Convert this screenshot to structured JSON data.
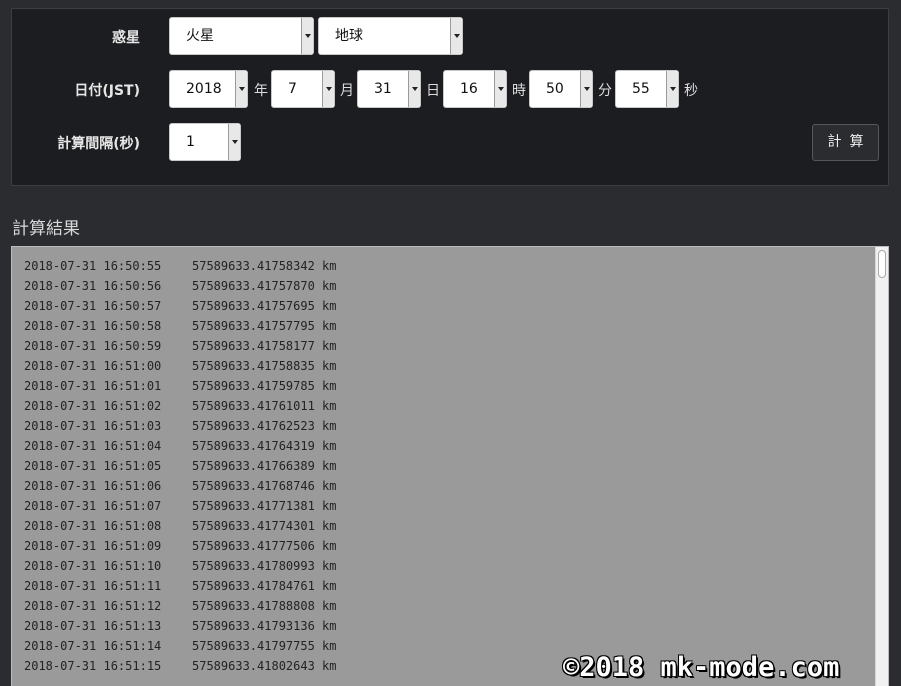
{
  "form": {
    "planet_label": "惑星",
    "planet_from": "火星",
    "planet_to": "地球",
    "date_label": "日付(JST)",
    "year": "2018",
    "year_unit": "年",
    "month": "7",
    "month_unit": "月",
    "day": "31",
    "day_unit": "日",
    "hour": "16",
    "hour_unit": "時",
    "minute": "50",
    "minute_unit": "分",
    "second": "55",
    "second_unit": "秒",
    "interval_label": "計算間隔(秒)",
    "interval": "1",
    "calc_button": "計算"
  },
  "results": {
    "title": "計算結果",
    "rows": [
      {
        "ts": "2018-07-31 16:50:55",
        "dist": "57589633.41758342 km"
      },
      {
        "ts": "2018-07-31 16:50:56",
        "dist": "57589633.41757870 km"
      },
      {
        "ts": "2018-07-31 16:50:57",
        "dist": "57589633.41757695 km"
      },
      {
        "ts": "2018-07-31 16:50:58",
        "dist": "57589633.41757795 km"
      },
      {
        "ts": "2018-07-31 16:50:59",
        "dist": "57589633.41758177 km"
      },
      {
        "ts": "2018-07-31 16:51:00",
        "dist": "57589633.41758835 km"
      },
      {
        "ts": "2018-07-31 16:51:01",
        "dist": "57589633.41759785 km"
      },
      {
        "ts": "2018-07-31 16:51:02",
        "dist": "57589633.41761011 km"
      },
      {
        "ts": "2018-07-31 16:51:03",
        "dist": "57589633.41762523 km"
      },
      {
        "ts": "2018-07-31 16:51:04",
        "dist": "57589633.41764319 km"
      },
      {
        "ts": "2018-07-31 16:51:05",
        "dist": "57589633.41766389 km"
      },
      {
        "ts": "2018-07-31 16:51:06",
        "dist": "57589633.41768746 km"
      },
      {
        "ts": "2018-07-31 16:51:07",
        "dist": "57589633.41771381 km"
      },
      {
        "ts": "2018-07-31 16:51:08",
        "dist": "57589633.41774301 km"
      },
      {
        "ts": "2018-07-31 16:51:09",
        "dist": "57589633.41777506 km"
      },
      {
        "ts": "2018-07-31 16:51:10",
        "dist": "57589633.41780993 km"
      },
      {
        "ts": "2018-07-31 16:51:11",
        "dist": "57589633.41784761 km"
      },
      {
        "ts": "2018-07-31 16:51:12",
        "dist": "57589633.41788808 km"
      },
      {
        "ts": "2018-07-31 16:51:13",
        "dist": "57589633.41793136 km"
      },
      {
        "ts": "2018-07-31 16:51:14",
        "dist": "57589633.41797755 km"
      },
      {
        "ts": "2018-07-31 16:51:15",
        "dist": "57589633.41802643 km"
      }
    ]
  },
  "watermark": "©2018 mk-mode.com",
  "icons": {
    "select_arrow": "chevron-down-icon"
  }
}
